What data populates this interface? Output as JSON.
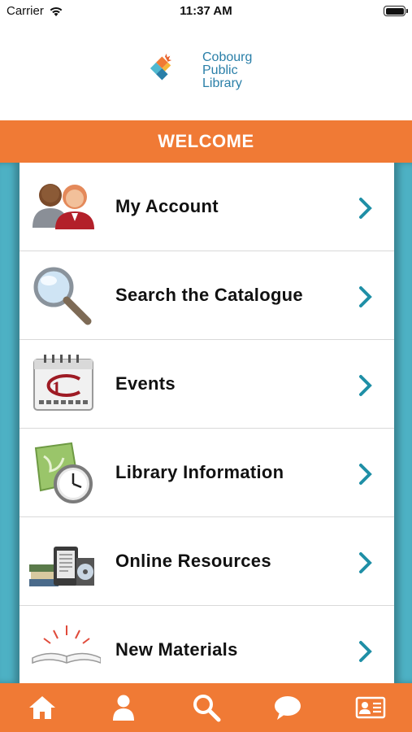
{
  "status": {
    "carrier": "Carrier",
    "time": "11:37 AM"
  },
  "logo": {
    "line1": "Cobourg",
    "line2": "Public",
    "line3": "Library"
  },
  "header": {
    "title": "WELCOME"
  },
  "menu": [
    {
      "label": "My Account",
      "icon": "people-icon"
    },
    {
      "label": "Search the Catalogue",
      "icon": "magnifier-icon"
    },
    {
      "label": "Events",
      "icon": "calendar-icon"
    },
    {
      "label": "Library Information",
      "icon": "map-clock-icon"
    },
    {
      "label": "Online Resources",
      "icon": "books-ereader-icon"
    },
    {
      "label": "New Materials",
      "icon": "open-book-icon"
    }
  ],
  "tabs": [
    "home-icon",
    "person-icon",
    "search-icon",
    "chat-icon",
    "id-card-icon"
  ],
  "colors": {
    "accent": "#f07a35",
    "teal": "#4db1c4",
    "chevron": "#1f8fa6",
    "logo_text": "#2a7fa8"
  }
}
